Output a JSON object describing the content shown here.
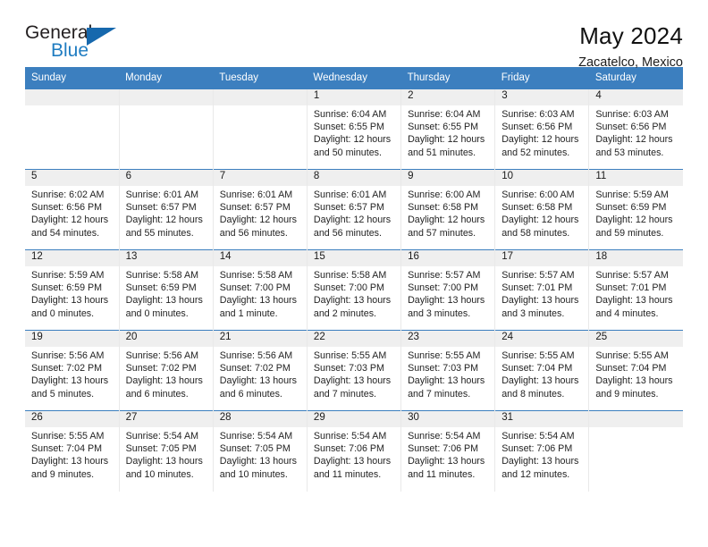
{
  "brand": {
    "name_top": "General",
    "name_bottom": "Blue",
    "triangle_color": "#1668ad",
    "blue_color": "#1f7cc1"
  },
  "header": {
    "title": "May 2024",
    "location": "Zacatelco, Mexico"
  },
  "theme": {
    "header_blue": "#3c7fbf",
    "daynum_band": "#efefef",
    "text": "#232323"
  },
  "calendar": {
    "weekday_headers": [
      "Sunday",
      "Monday",
      "Tuesday",
      "Wednesday",
      "Thursday",
      "Friday",
      "Saturday"
    ],
    "weeks": [
      [
        {
          "day": "",
          "empty": true
        },
        {
          "day": "",
          "empty": true
        },
        {
          "day": "",
          "empty": true
        },
        {
          "day": "1",
          "sunrise": "Sunrise: 6:04 AM",
          "sunset": "Sunset: 6:55 PM",
          "daylight1": "Daylight: 12 hours",
          "daylight2": "and 50 minutes."
        },
        {
          "day": "2",
          "sunrise": "Sunrise: 6:04 AM",
          "sunset": "Sunset: 6:55 PM",
          "daylight1": "Daylight: 12 hours",
          "daylight2": "and 51 minutes."
        },
        {
          "day": "3",
          "sunrise": "Sunrise: 6:03 AM",
          "sunset": "Sunset: 6:56 PM",
          "daylight1": "Daylight: 12 hours",
          "daylight2": "and 52 minutes."
        },
        {
          "day": "4",
          "sunrise": "Sunrise: 6:03 AM",
          "sunset": "Sunset: 6:56 PM",
          "daylight1": "Daylight: 12 hours",
          "daylight2": "and 53 minutes."
        }
      ],
      [
        {
          "day": "5",
          "sunrise": "Sunrise: 6:02 AM",
          "sunset": "Sunset: 6:56 PM",
          "daylight1": "Daylight: 12 hours",
          "daylight2": "and 54 minutes."
        },
        {
          "day": "6",
          "sunrise": "Sunrise: 6:01 AM",
          "sunset": "Sunset: 6:57 PM",
          "daylight1": "Daylight: 12 hours",
          "daylight2": "and 55 minutes."
        },
        {
          "day": "7",
          "sunrise": "Sunrise: 6:01 AM",
          "sunset": "Sunset: 6:57 PM",
          "daylight1": "Daylight: 12 hours",
          "daylight2": "and 56 minutes."
        },
        {
          "day": "8",
          "sunrise": "Sunrise: 6:01 AM",
          "sunset": "Sunset: 6:57 PM",
          "daylight1": "Daylight: 12 hours",
          "daylight2": "and 56 minutes."
        },
        {
          "day": "9",
          "sunrise": "Sunrise: 6:00 AM",
          "sunset": "Sunset: 6:58 PM",
          "daylight1": "Daylight: 12 hours",
          "daylight2": "and 57 minutes."
        },
        {
          "day": "10",
          "sunrise": "Sunrise: 6:00 AM",
          "sunset": "Sunset: 6:58 PM",
          "daylight1": "Daylight: 12 hours",
          "daylight2": "and 58 minutes."
        },
        {
          "day": "11",
          "sunrise": "Sunrise: 5:59 AM",
          "sunset": "Sunset: 6:59 PM",
          "daylight1": "Daylight: 12 hours",
          "daylight2": "and 59 minutes."
        }
      ],
      [
        {
          "day": "12",
          "sunrise": "Sunrise: 5:59 AM",
          "sunset": "Sunset: 6:59 PM",
          "daylight1": "Daylight: 13 hours",
          "daylight2": "and 0 minutes."
        },
        {
          "day": "13",
          "sunrise": "Sunrise: 5:58 AM",
          "sunset": "Sunset: 6:59 PM",
          "daylight1": "Daylight: 13 hours",
          "daylight2": "and 0 minutes."
        },
        {
          "day": "14",
          "sunrise": "Sunrise: 5:58 AM",
          "sunset": "Sunset: 7:00 PM",
          "daylight1": "Daylight: 13 hours",
          "daylight2": "and 1 minute."
        },
        {
          "day": "15",
          "sunrise": "Sunrise: 5:58 AM",
          "sunset": "Sunset: 7:00 PM",
          "daylight1": "Daylight: 13 hours",
          "daylight2": "and 2 minutes."
        },
        {
          "day": "16",
          "sunrise": "Sunrise: 5:57 AM",
          "sunset": "Sunset: 7:00 PM",
          "daylight1": "Daylight: 13 hours",
          "daylight2": "and 3 minutes."
        },
        {
          "day": "17",
          "sunrise": "Sunrise: 5:57 AM",
          "sunset": "Sunset: 7:01 PM",
          "daylight1": "Daylight: 13 hours",
          "daylight2": "and 3 minutes."
        },
        {
          "day": "18",
          "sunrise": "Sunrise: 5:57 AM",
          "sunset": "Sunset: 7:01 PM",
          "daylight1": "Daylight: 13 hours",
          "daylight2": "and 4 minutes."
        }
      ],
      [
        {
          "day": "19",
          "sunrise": "Sunrise: 5:56 AM",
          "sunset": "Sunset: 7:02 PM",
          "daylight1": "Daylight: 13 hours",
          "daylight2": "and 5 minutes."
        },
        {
          "day": "20",
          "sunrise": "Sunrise: 5:56 AM",
          "sunset": "Sunset: 7:02 PM",
          "daylight1": "Daylight: 13 hours",
          "daylight2": "and 6 minutes."
        },
        {
          "day": "21",
          "sunrise": "Sunrise: 5:56 AM",
          "sunset": "Sunset: 7:02 PM",
          "daylight1": "Daylight: 13 hours",
          "daylight2": "and 6 minutes."
        },
        {
          "day": "22",
          "sunrise": "Sunrise: 5:55 AM",
          "sunset": "Sunset: 7:03 PM",
          "daylight1": "Daylight: 13 hours",
          "daylight2": "and 7 minutes."
        },
        {
          "day": "23",
          "sunrise": "Sunrise: 5:55 AM",
          "sunset": "Sunset: 7:03 PM",
          "daylight1": "Daylight: 13 hours",
          "daylight2": "and 7 minutes."
        },
        {
          "day": "24",
          "sunrise": "Sunrise: 5:55 AM",
          "sunset": "Sunset: 7:04 PM",
          "daylight1": "Daylight: 13 hours",
          "daylight2": "and 8 minutes."
        },
        {
          "day": "25",
          "sunrise": "Sunrise: 5:55 AM",
          "sunset": "Sunset: 7:04 PM",
          "daylight1": "Daylight: 13 hours",
          "daylight2": "and 9 minutes."
        }
      ],
      [
        {
          "day": "26",
          "sunrise": "Sunrise: 5:55 AM",
          "sunset": "Sunset: 7:04 PM",
          "daylight1": "Daylight: 13 hours",
          "daylight2": "and 9 minutes."
        },
        {
          "day": "27",
          "sunrise": "Sunrise: 5:54 AM",
          "sunset": "Sunset: 7:05 PM",
          "daylight1": "Daylight: 13 hours",
          "daylight2": "and 10 minutes."
        },
        {
          "day": "28",
          "sunrise": "Sunrise: 5:54 AM",
          "sunset": "Sunset: 7:05 PM",
          "daylight1": "Daylight: 13 hours",
          "daylight2": "and 10 minutes."
        },
        {
          "day": "29",
          "sunrise": "Sunrise: 5:54 AM",
          "sunset": "Sunset: 7:06 PM",
          "daylight1": "Daylight: 13 hours",
          "daylight2": "and 11 minutes."
        },
        {
          "day": "30",
          "sunrise": "Sunrise: 5:54 AM",
          "sunset": "Sunset: 7:06 PM",
          "daylight1": "Daylight: 13 hours",
          "daylight2": "and 11 minutes."
        },
        {
          "day": "31",
          "sunrise": "Sunrise: 5:54 AM",
          "sunset": "Sunset: 7:06 PM",
          "daylight1": "Daylight: 13 hours",
          "daylight2": "and 12 minutes."
        },
        {
          "day": "",
          "empty": true
        }
      ]
    ]
  }
}
